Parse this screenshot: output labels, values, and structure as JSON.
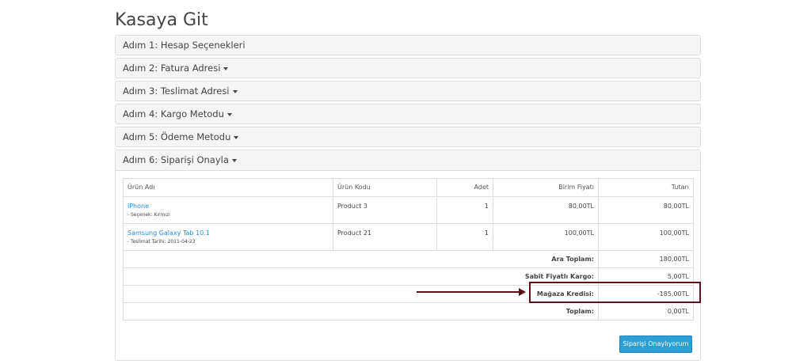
{
  "page": {
    "title": "Kasaya Git"
  },
  "steps": [
    {
      "label": "Adım 1: Hesap Seçenekleri",
      "has_caret": false
    },
    {
      "label": "Adım 2: Fatura Adresi",
      "has_caret": true
    },
    {
      "label": "Adım 3: Teslimat Adresi",
      "has_caret": true
    },
    {
      "label": "Adım 4: Kargo Metodu",
      "has_caret": true
    },
    {
      "label": "Adım 5: Ödeme Metodu",
      "has_caret": true
    },
    {
      "label": "Adım 6: Siparişi Onayla",
      "has_caret": true
    }
  ],
  "table": {
    "headers": [
      "Ürün Adı",
      "Ürün Kodu",
      "Adet",
      "Birim Fiyatı",
      "Tutarı"
    ],
    "products": [
      {
        "name": "iPhone",
        "option": "- Seçenek: Kırmızı",
        "code": "Product 3",
        "qty": "1",
        "unit_price": "80,00TL",
        "total": "80,00TL"
      },
      {
        "name": "Samsung Galaxy Tab 10.1",
        "option": "- Teslimat Tarihi: 2011-04-23",
        "code": "Product 21",
        "qty": "1",
        "unit_price": "100,00TL",
        "total": "100,00TL"
      }
    ],
    "totals": [
      {
        "label": "Ara Toplam:",
        "value": "180,00TL"
      },
      {
        "label": "Sabit Fiyatlı Kargo:",
        "value": "5,00TL"
      },
      {
        "label": "Mağaza Kredisi:",
        "value": "-185,00TL"
      },
      {
        "label": "Toplam:",
        "value": "0,00TL"
      }
    ]
  },
  "actions": {
    "confirm_label": "Siparişi Onaylıyorum"
  },
  "colors": {
    "link": "#2a8ac9",
    "button": "#2b9fd6",
    "highlight": "#5a1218"
  }
}
